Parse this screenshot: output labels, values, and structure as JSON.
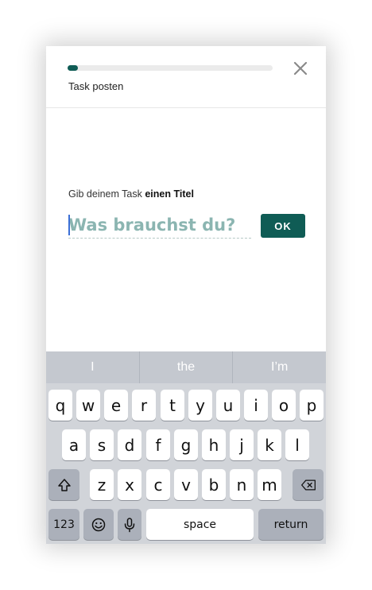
{
  "header": {
    "title": "Task posten",
    "progress_fraction": 0.05,
    "close_icon": "close-icon"
  },
  "content": {
    "prompt_prefix": "Gib deinem Task ",
    "prompt_bold": "einen Titel",
    "title_placeholder": "Was brauchst du?",
    "title_value": "",
    "ok_label": "OK"
  },
  "colors": {
    "accent": "#0f5c55",
    "placeholder": "#8bb5b1"
  },
  "keyboard": {
    "suggestions": [
      "I",
      "the",
      "I’m"
    ],
    "row1": [
      "q",
      "w",
      "e",
      "r",
      "t",
      "y",
      "u",
      "i",
      "o",
      "p"
    ],
    "row2": [
      "a",
      "s",
      "d",
      "f",
      "g",
      "h",
      "j",
      "k",
      "l"
    ],
    "row3": [
      "z",
      "x",
      "c",
      "v",
      "b",
      "n",
      "m"
    ],
    "numbers_label": "123",
    "space_label": "space",
    "return_label": "return"
  }
}
